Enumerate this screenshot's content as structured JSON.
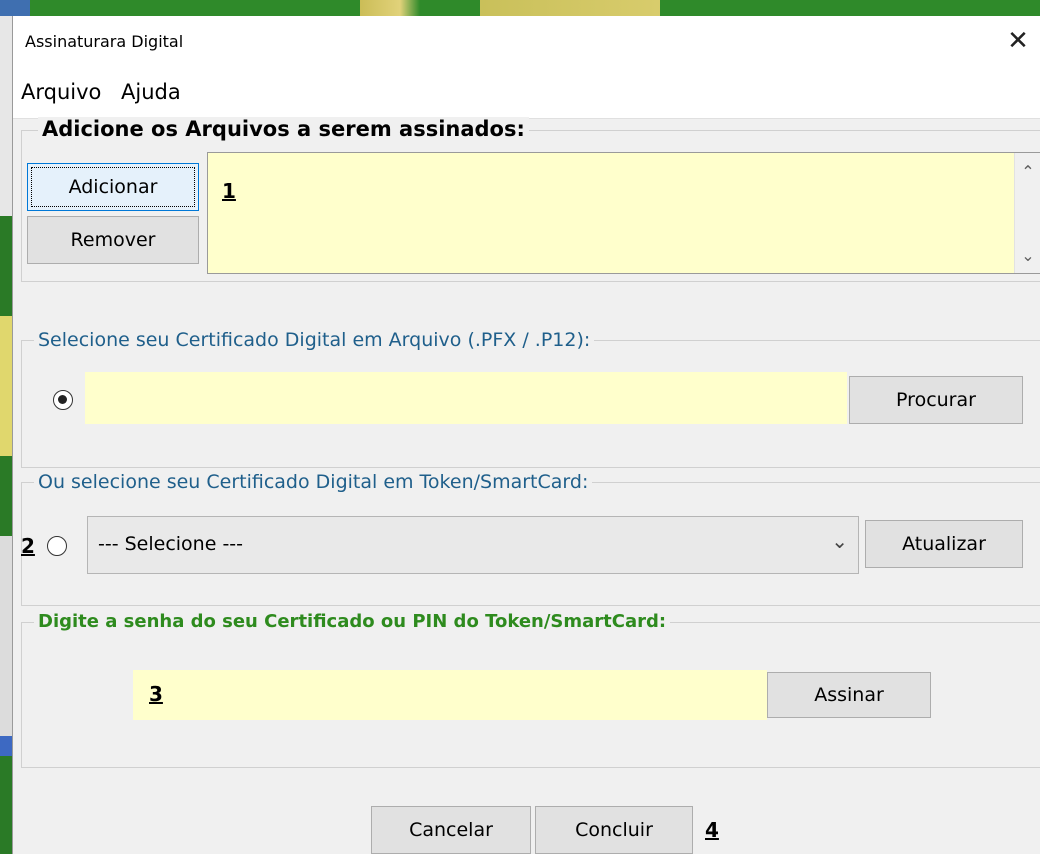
{
  "window": {
    "title": "Assinaturara Digital"
  },
  "menu": {
    "arquivo": "Arquivo",
    "ajuda": "Ajuda"
  },
  "files_group": {
    "legend": "Adicione os Arquivos a serem assinados:",
    "add_button": "Adicionar",
    "remove_button": "Remover",
    "marker": "1"
  },
  "pfx_group": {
    "legend": "Selecione seu Certificado Digital em Arquivo (.PFX / .P12):",
    "browse_button": "Procurar",
    "path_value": ""
  },
  "token_group": {
    "legend": "Ou selecione seu Certificado Digital em Token/SmartCard:",
    "marker": "2",
    "select_value": "--- Selecione ---",
    "refresh_button": "Atualizar"
  },
  "password_group": {
    "legend": "Digite a senha do seu Certificado ou PIN do Token/SmartCard:",
    "marker": "3",
    "sign_button": "Assinar",
    "password_value": ""
  },
  "footer": {
    "cancel_button": "Cancelar",
    "finish_button": "Concluir",
    "marker": "4"
  },
  "colors": {
    "field_bg": "#ffffcc",
    "password_legend": "#2e8b1e",
    "legend_text": "#1f5f8b"
  },
  "icons": {
    "close": "close-icon",
    "scroll_up": "chevron-up-icon",
    "scroll_down": "chevron-down-icon",
    "dropdown": "chevron-down-icon"
  }
}
